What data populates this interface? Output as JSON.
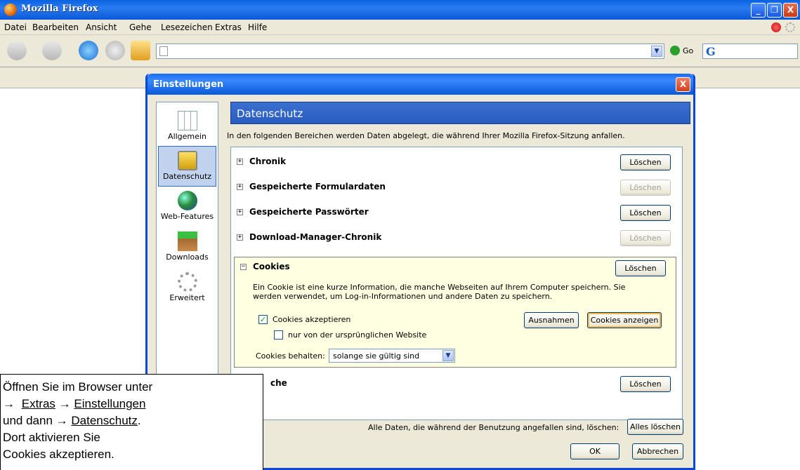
{
  "window": {
    "title": "Mozilla Firefox",
    "min": "_",
    "restore": "❐",
    "close": "X"
  },
  "menu": [
    {
      "label": "Datei"
    },
    {
      "label": "Bearbeiten"
    },
    {
      "label": "Ansicht"
    },
    {
      "label": "Gehe"
    },
    {
      "label": "Lesezeichen"
    },
    {
      "label": "Extras"
    },
    {
      "label": "Hilfe"
    }
  ],
  "toolbar": {
    "url_value": "",
    "go_label": "Go",
    "search_logo": "G"
  },
  "dialog": {
    "title": "Einstellungen",
    "close": "X",
    "sidebar": [
      {
        "label": "Allgemein",
        "icon": "sliders-icon"
      },
      {
        "label": "Datenschutz",
        "icon": "lock-icon",
        "selected": true
      },
      {
        "label": "Web-Features",
        "icon": "globe-icon"
      },
      {
        "label": "Downloads",
        "icon": "download-box-icon"
      },
      {
        "label": "Erweitert",
        "icon": "gear-icon"
      }
    ],
    "pane_title": "Datenschutz",
    "intro": "In den folgenden Bereichen werden Daten abgelegt, die während Ihrer Mozilla Firefox-Sitzung anfallen.",
    "sections": [
      {
        "name": "Chronik",
        "button": "Löschen",
        "enabled": true
      },
      {
        "name": "Gespeicherte Formulardaten",
        "button": "Löschen",
        "enabled": false
      },
      {
        "name": "Gespeicherte Passwörter",
        "button": "Löschen",
        "enabled": true
      },
      {
        "name": "Download-Manager-Chronik",
        "button": "Löschen",
        "enabled": false
      }
    ],
    "cookies": {
      "name": "Cookies",
      "button": "Löschen",
      "description": "Ein Cookie ist eine kurze Information, die manche Webseiten auf Ihrem Computer speichern. Sie werden verwendet, um Log-in-Informationen und andere Daten zu speichern.",
      "accept_label": "Cookies akzeptieren",
      "accept_checked": true,
      "origin_label": "nur von der ursprünglichen Website",
      "origin_checked": false,
      "exceptions_button": "Ausnahmen",
      "show_button": "Cookies anzeigen",
      "keep_label": "Cookies behalten:",
      "keep_value": "solange sie gültig sind"
    },
    "cache": {
      "name_partial": "che",
      "button": "Löschen"
    },
    "bottom_text": "Alle Daten, die während der Benutzung angefallen sind, löschen:",
    "clear_all": "Alles löschen",
    "ok": "OK",
    "cancel": "Abbrechen"
  },
  "note": {
    "line1": "Öffnen Sie im Browser unter",
    "arrow": "→",
    "extras": "Extras",
    "einstellungen": "Einstellungen",
    "und_dann": "und dann",
    "datenschutz": "Datenschutz",
    "period": ".",
    "line4": "Dort aktivieren Sie",
    "line5": "Cookies akzeptieren."
  }
}
